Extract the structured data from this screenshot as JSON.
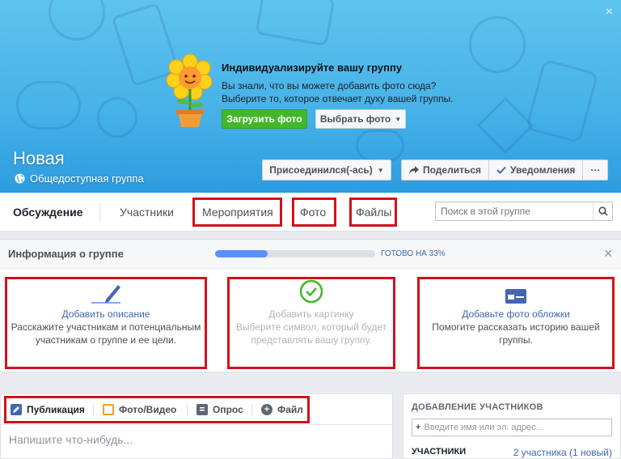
{
  "cover": {
    "close_icon": "×",
    "promo": {
      "title": "Индивидуализируйте вашу группу",
      "text": "Вы знали, что вы можете добавить фото сюда? Выберите то, которое отвечает духу вашей группы.",
      "upload_label": "Загрузить фото",
      "choose_label": "Выбрать фото"
    },
    "group_name": "Новая",
    "group_type": "Общедоступная группа",
    "joined_label": "Присоединился(-ась)",
    "share_label": "Поделиться",
    "notifications_label": "Уведомления",
    "more_label": "···"
  },
  "tabs": {
    "discussion": "Обсуждение",
    "members": "Участники",
    "events": "Мероприятия",
    "photos": "Фото",
    "files": "Файлы"
  },
  "search": {
    "placeholder": "Поиск в этой группе"
  },
  "info": {
    "title": "Информация о группе",
    "progress_percent": 33,
    "progress_text": "ГОТОВО НА 33%",
    "cards": [
      {
        "link": "Добавить описание",
        "text": "Расскажите участникам и потенциальным участникам о группе и ее цели."
      },
      {
        "link": "Добавить картинку",
        "text": "Выберите символ, который будет представлять вашу группу."
      },
      {
        "link": "Добавьте фото обложки",
        "text": "Помогите рассказать историю вашей группы."
      }
    ]
  },
  "composer": {
    "tabs": [
      "Публикация",
      "Фото/Видео",
      "Опрос",
      "Файл"
    ],
    "placeholder": "Напишите что-нибудь..."
  },
  "add_members": {
    "title": "ДОБАВЛЕНИЕ УЧАСТНИКОВ",
    "input_placeholder": "Введите имя или эл. адрес...",
    "members_label": "УЧАСТНИКИ",
    "members_count": "2 участника (1 новый)"
  },
  "colors": {
    "accent": "#4267b2",
    "green": "#42b72a",
    "highlight": "#d0121b",
    "progress": "#5890ff"
  }
}
